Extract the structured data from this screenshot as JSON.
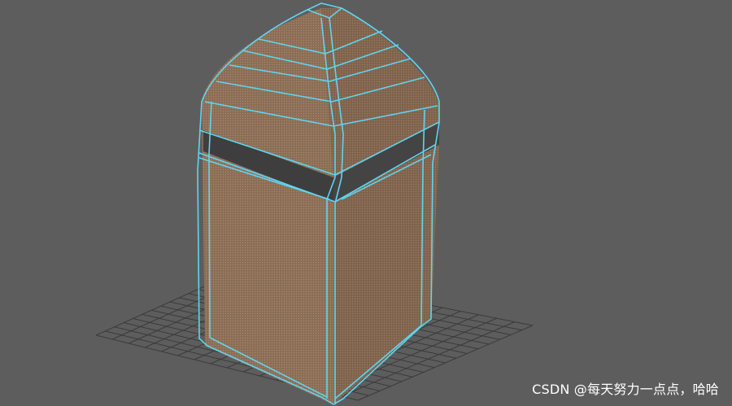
{
  "viewport": {
    "background_color": "#5d5d5d",
    "grid_color": "#3a3a3a",
    "wireframe_color": "#5fd4f0",
    "surface_color": "#8c6e55",
    "band_color": "#3c3c3c"
  },
  "model": {
    "object": "capsule-topped box mesh (wireframe on shaded)"
  },
  "watermark": {
    "text": "CSDN @每天努力一点点，哈哈"
  }
}
